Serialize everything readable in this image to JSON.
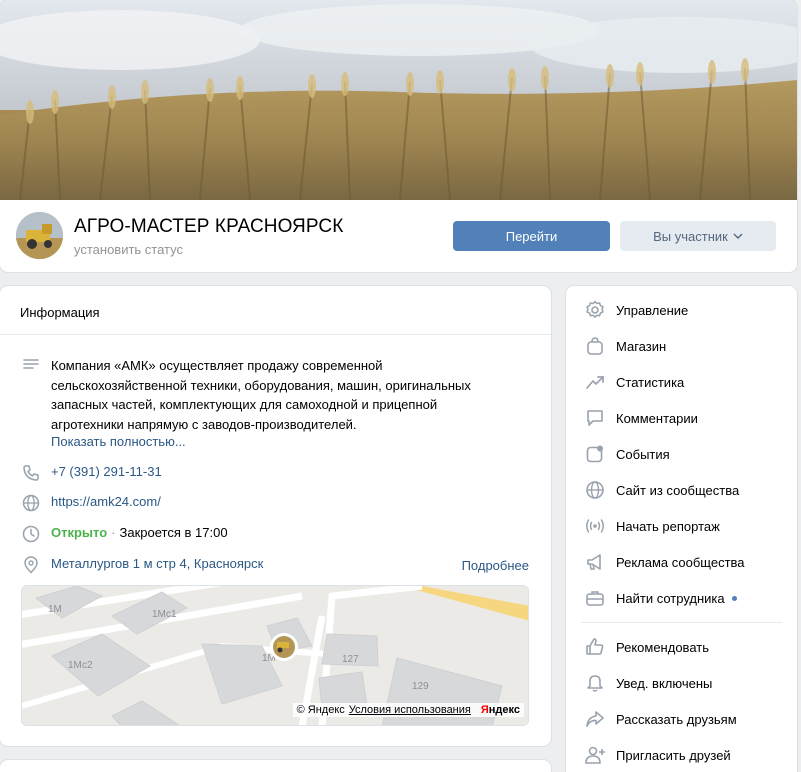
{
  "header": {
    "title": "АГРО-МАСТЕР КРАСНОЯРСК",
    "status": "установить статус",
    "go_button": "Перейти",
    "member_button": "Вы участник"
  },
  "info": {
    "heading": "Информация",
    "description": "Компания «АМК» осуществляет продажу современной сельскохозяйственной техники, оборудования, машин, оригинальных запасных частей, комплектующих для самоходной и прицепной агротехники напрямую с заводов-производителей.",
    "show_more": "Показать полностью...",
    "phone": "+7 (391) 291-11-31",
    "website": "https://amk24.com/",
    "open_status": "Открыто",
    "open_separator": "·",
    "closes": "Закроется в 17:00",
    "address": "Металлургов 1 м стр 4, Красноярск",
    "address_more": "Подробнее"
  },
  "map": {
    "labels": [
      "1М",
      "1Мс1",
      "1Мс2",
      "127",
      "129",
      "1М"
    ],
    "copyright": "© Яндекс",
    "terms": "Условия использования",
    "brand_red": "Я",
    "brand_black": "ндекс"
  },
  "menu": {
    "items": [
      {
        "label": "Управление",
        "icon": "gear-icon"
      },
      {
        "label": "Магазин",
        "icon": "bag-icon"
      },
      {
        "label": "Статистика",
        "icon": "chart-icon"
      },
      {
        "label": "Комментарии",
        "icon": "comment-icon"
      },
      {
        "label": "События",
        "icon": "events-icon"
      },
      {
        "label": "Сайт из сообщества",
        "icon": "globe-icon"
      },
      {
        "label": "Начать репортаж",
        "icon": "broadcast-icon"
      },
      {
        "label": "Реклама сообщества",
        "icon": "megaphone-icon"
      },
      {
        "label": "Найти сотрудника",
        "icon": "briefcase-icon"
      }
    ],
    "items2": [
      {
        "label": "Рекомендовать",
        "icon": "thumb-up-icon"
      },
      {
        "label": "Увед. включены",
        "icon": "bell-icon"
      },
      {
        "label": "Рассказать друзьям",
        "icon": "share-icon"
      },
      {
        "label": "Пригласить друзей",
        "icon": "add-user-icon"
      }
    ]
  },
  "colors": {
    "accent": "#5181b8",
    "link": "#2a5885",
    "open": "#4bb34b",
    "background": "#edeef0"
  }
}
